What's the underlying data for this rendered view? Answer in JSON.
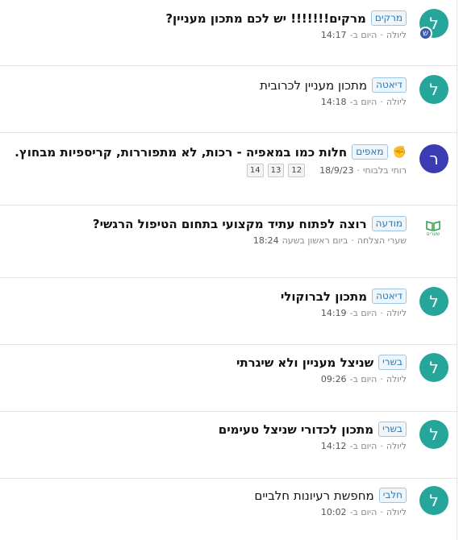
{
  "topics": [
    {
      "category": "מרקים",
      "title": "מרקים!!!!!!! יש לכם מתכון מעניין?",
      "author": "ליולה",
      "separator": "·",
      "time_text": "היום ב-",
      "time": "14:17",
      "avatar_letter": "ל",
      "avatar_color": "#26a69a",
      "sub_avatar_letter": "ש"
    },
    {
      "category": "דיאטה",
      "title": "מתכון מעניין לכרובית",
      "author": "ליולה",
      "separator": "·",
      "time_text": "היום ב-",
      "time": "14:18",
      "avatar_letter": "ל",
      "avatar_color": "#26a69a"
    },
    {
      "category": "מאפים",
      "title": "חלות כמו במאפיה - רכות, לא מתפוררות, קריספיות מבחוץ.",
      "author": "רוחי בלבוחי",
      "separator": "·",
      "date": "18/9/23",
      "pages": [
        "12",
        "13",
        "14"
      ],
      "avatar_letter": "ר",
      "avatar_color": "#3b3bb3",
      "icon": "raised-fist-icon"
    },
    {
      "category": "מודעה",
      "title": "רוצה לפתוח עתיד מקצועי בתחום הטיפול הרגשי?",
      "author": "שערי הצלחה",
      "separator": "·",
      "time_text": "ביום ראשון בשעה",
      "time": "18:24",
      "logo_text": "שערים",
      "logo_color": "#2e9b55"
    },
    {
      "category": "דיאטה",
      "title": "מתכון לברוקולי",
      "author": "ליולה",
      "separator": "·",
      "time_text": "היום ב-",
      "time": "14:19",
      "avatar_letter": "ל",
      "avatar_color": "#26a69a"
    },
    {
      "category": "בשרי",
      "title": "שניצל מעניין ולא שיגרתי",
      "author": "ליולה",
      "separator": "·",
      "time_text": "היום ב-",
      "time": "09:26",
      "avatar_letter": "ל",
      "avatar_color": "#26a69a"
    },
    {
      "category": "בשרי",
      "title": "מתכון לכדורי שניצל טעימים",
      "author": "ליולה",
      "separator": "·",
      "time_text": "היום ב-",
      "time": "14:12",
      "avatar_letter": "ל",
      "avatar_color": "#26a69a"
    },
    {
      "category": "חלבי",
      "title": "מחפשת רעיונות חלביים",
      "author": "ליולה",
      "separator": "·",
      "time_text": "היום ב-",
      "time": "10:02",
      "avatar_letter": "ל",
      "avatar_color": "#26a69a"
    }
  ]
}
